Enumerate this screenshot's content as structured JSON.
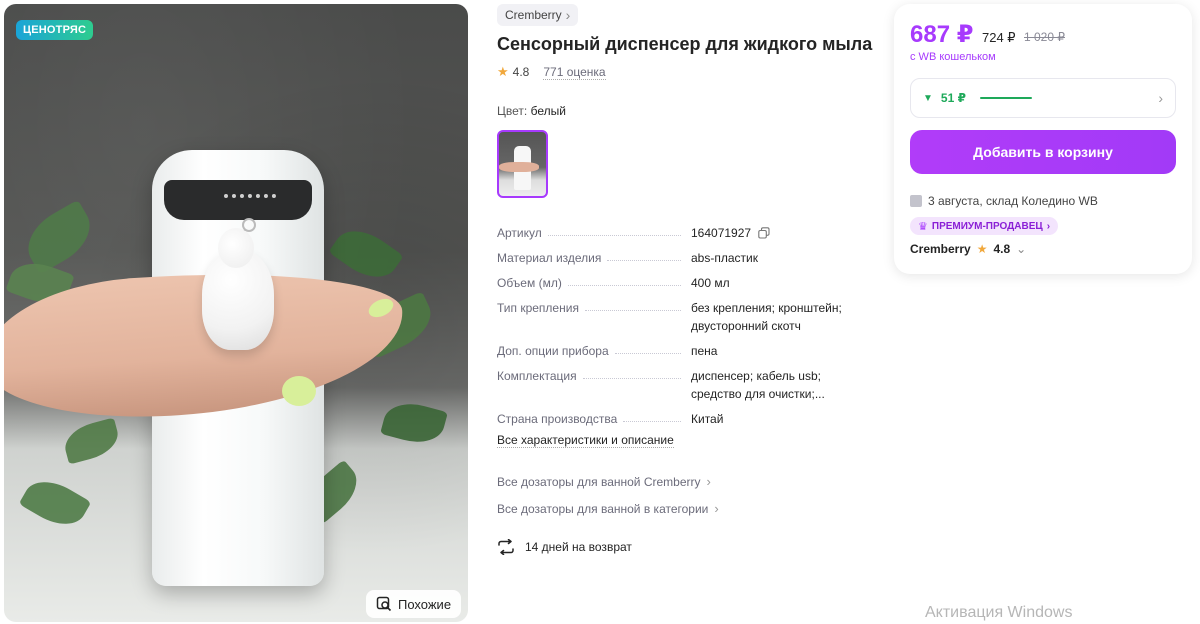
{
  "photo": {
    "badge": "ЦЕНОТРЯС",
    "similar_button": "Похожие"
  },
  "product": {
    "brand": "Cremberry",
    "title": "Сенсорный диспенсер для жидкого мыла",
    "rating": "4.8",
    "reviews": "771 оценка",
    "color_label": "Цвет:",
    "color_value": "белый"
  },
  "specs": [
    {
      "key": "Артикул",
      "value": "164071927"
    },
    {
      "key": "Материал изделия",
      "value": "abs-пластик"
    },
    {
      "key": "Объем (мл)",
      "value": "400 мл"
    },
    {
      "key": "Тип крепления",
      "value": "без крепления; кронштейн; двусторонний скотч"
    },
    {
      "key": "Доп. опции прибора",
      "value": "пена"
    },
    {
      "key": "Комплектация",
      "value": "диспенсер; кабель usb; средство для очистки;..."
    },
    {
      "key": "Страна производства",
      "value": "Китай"
    }
  ],
  "links": {
    "all_specs": "Все характеристики и описание",
    "brand_category": "Все дозаторы для ванной Cremberry",
    "category": "Все дозаторы для ванной в категории",
    "return_policy": "14 дней на возврат"
  },
  "buy": {
    "price": "687 ₽",
    "price_regular": "724 ₽",
    "price_old": "1 020 ₽",
    "wallet_note": "с WB кошельком",
    "installment": "51 ₽",
    "cart_button": "Добавить в корзину",
    "delivery": "3 августа, склад Коледино WB",
    "premium_badge": "ПРЕМИУМ-ПРОДАВЕЦ",
    "seller_name": "Cremberry",
    "seller_rating": "4.8"
  },
  "os_watermark": "Активация Windows",
  "colors": {
    "accent": "#a73afd",
    "green": "#1ea95a",
    "star": "#f1a83c"
  }
}
